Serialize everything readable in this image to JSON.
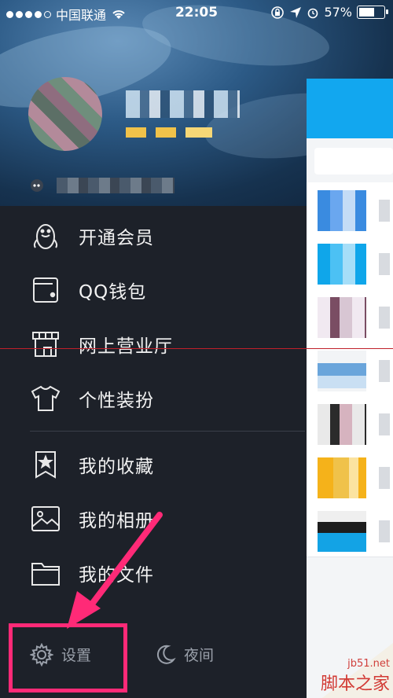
{
  "status_bar": {
    "carrier": "中国联通",
    "time": "22:05",
    "battery": "57%"
  },
  "menu": {
    "items": [
      {
        "label": "开通会员",
        "icon": "penguin-icon"
      },
      {
        "label": "QQ钱包",
        "icon": "wallet-icon"
      },
      {
        "label": "网上营业厅",
        "icon": "store-icon"
      },
      {
        "label": "个性装扮",
        "icon": "tshirt-icon"
      },
      {
        "label": "我的收藏",
        "icon": "bookmark-star-icon"
      },
      {
        "label": "我的相册",
        "icon": "image-icon"
      },
      {
        "label": "我的文件",
        "icon": "folder-icon"
      }
    ]
  },
  "bottom_bar": {
    "settings_label": "设置",
    "night_label": "夜间"
  },
  "watermark": {
    "url": "jb51.net",
    "brand": "脚本之家"
  },
  "colors": {
    "sidebar_bg": "#1d2129",
    "highlight": "#ff2a77",
    "panel_header": "#12a7ef"
  }
}
